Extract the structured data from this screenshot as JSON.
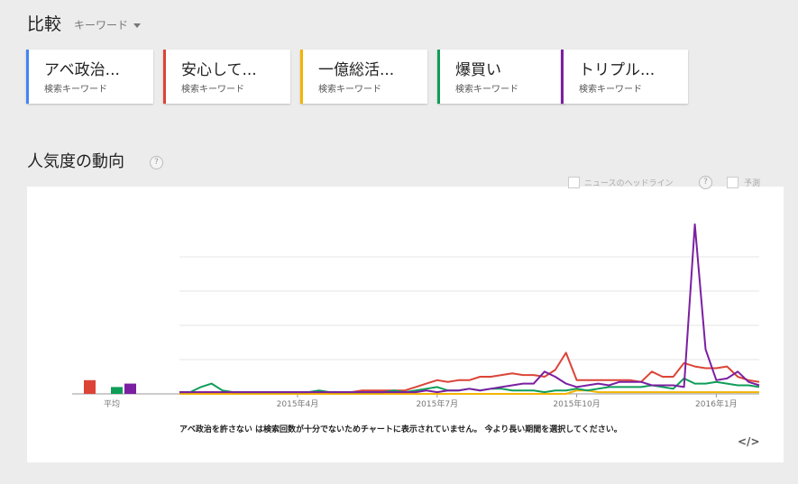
{
  "header": {
    "title": "比較",
    "dropdown_label": "キーワード"
  },
  "keywords": [
    {
      "label": "アベ政治...",
      "sub": "検索キーワード",
      "color": "#4285f4"
    },
    {
      "label": "安心して...",
      "sub": "検索キーワード",
      "color": "#db4437"
    },
    {
      "label": "一億総活...",
      "sub": "検索キーワード",
      "color": "#f4b400"
    },
    {
      "label": "爆買い",
      "sub": "検索キーワード",
      "color": "#0f9d58"
    },
    {
      "label": "トリプル...",
      "sub": "検索キーワード",
      "color": "#7b1fa2"
    }
  ],
  "section": {
    "title": "人気度の動向",
    "help": "?"
  },
  "options": {
    "headlines_label": "ニュースのヘッドライン",
    "forecast_label": "予測",
    "help": "?"
  },
  "notice": "アベ政治を許さない は検索回数が十分でないためチャートに表示されていません。 今より長い期間を選択してください。",
  "embed_label": "</>",
  "chart_data": {
    "type": "line",
    "ylim": [
      0,
      100
    ],
    "grid": true,
    "x_tick_labels": [
      "2015年4月",
      "2015年7月",
      "2015年10月",
      "2016年1月"
    ],
    "x_tick_index": [
      11,
      24,
      37,
      50
    ],
    "average": {
      "label": "平均",
      "bars": [
        {
          "series": "安心して...",
          "value": 8,
          "color": "#db4437"
        },
        {
          "series": "爆買い",
          "value": 4,
          "color": "#0f9d58"
        },
        {
          "series": "トリプル...",
          "value": 6,
          "color": "#7b1fa2"
        }
      ]
    },
    "series": [
      {
        "name": "安心して...",
        "color": "#db4437",
        "values": [
          1,
          1,
          1,
          1,
          1,
          1,
          1,
          1,
          1,
          1,
          1,
          1,
          1,
          1,
          1,
          1,
          1,
          2,
          2,
          2,
          2,
          2,
          4,
          6,
          8,
          7,
          8,
          8,
          10,
          10,
          11,
          12,
          11,
          11,
          10,
          14,
          24,
          8,
          8,
          8,
          8,
          8,
          8,
          7,
          13,
          10,
          10,
          18,
          16,
          15,
          15,
          16,
          10,
          8,
          7
        ]
      },
      {
        "name": "一億総活...",
        "color": "#f4b400",
        "values": [
          0,
          0,
          0,
          0,
          0,
          0,
          0,
          0,
          0,
          0,
          0,
          0,
          0,
          0,
          0,
          0,
          0,
          0,
          0,
          0,
          0,
          0,
          0,
          0,
          0,
          0,
          0,
          0,
          0,
          0,
          0,
          0,
          0,
          0,
          0,
          0,
          0,
          2,
          2,
          1,
          1,
          1,
          1,
          1,
          1,
          1,
          1,
          1,
          1,
          1,
          1,
          1,
          1,
          1,
          1
        ]
      },
      {
        "name": "爆買い",
        "color": "#0f9d58",
        "values": [
          1,
          1,
          4,
          6,
          2,
          1,
          1,
          1,
          1,
          1,
          1,
          1,
          1,
          2,
          1,
          1,
          1,
          1,
          1,
          1,
          2,
          1,
          2,
          3,
          4,
          2,
          2,
          3,
          2,
          3,
          3,
          2,
          2,
          2,
          1,
          2,
          2,
          3,
          2,
          3,
          4,
          4,
          4,
          4,
          5,
          4,
          3,
          9,
          6,
          6,
          7,
          6,
          5,
          5,
          4
        ]
      },
      {
        "name": "トリプル...",
        "color": "#7b1fa2",
        "values": [
          1,
          1,
          1,
          1,
          1,
          1,
          1,
          1,
          1,
          1,
          1,
          1,
          1,
          1,
          1,
          1,
          1,
          1,
          1,
          1,
          1,
          1,
          1,
          2,
          1,
          2,
          2,
          3,
          2,
          3,
          4,
          5,
          6,
          6,
          13,
          10,
          6,
          4,
          5,
          6,
          5,
          7,
          7,
          7,
          5,
          5,
          5,
          4,
          99,
          26,
          8,
          9,
          13,
          7,
          5
        ]
      }
    ]
  }
}
